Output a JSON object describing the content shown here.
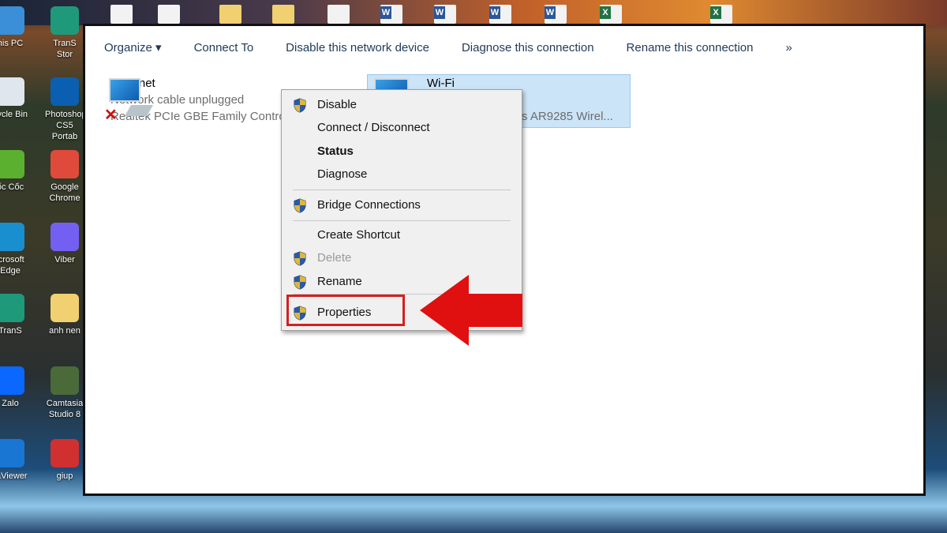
{
  "desktop": {
    "left_icons": [
      {
        "label": "his PC",
        "color": "#3a8fd8"
      },
      {
        "label": "cycle Bin",
        "color": "#dfe6ee"
      },
      {
        "label": "ốc Cốc",
        "color": "#5cb030"
      },
      {
        "label": "icrosoft Edge",
        "color": "#1a8fd0"
      },
      {
        "label": "TranS",
        "color": "#1e9a7a"
      },
      {
        "label": "Zalo",
        "color": "#0a68ff"
      },
      {
        "label": "raViewer",
        "color": "#1976d2"
      }
    ],
    "right_icons": [
      {
        "label": "TranS Stor",
        "color": "#1e9a7a"
      },
      {
        "label": "Photoshop CS5 Portab",
        "color": "#0b5fb0"
      },
      {
        "label": "Google Chrome",
        "color": "#e04a3a"
      },
      {
        "label": "Viber",
        "color": "#7360f2"
      },
      {
        "label": "anh nen",
        "color": "#f0d070"
      },
      {
        "label": "Camtasia Studio 8",
        "color": "#4a6a3a"
      },
      {
        "label": "giup",
        "color": "#d03030"
      }
    ]
  },
  "toolbar": {
    "organize": "Organize ▾",
    "connect_to": "Connect To",
    "disable": "Disable this network device",
    "diagnose": "Diagnose this connection",
    "rename": "Rename this connection",
    "more": "»"
  },
  "connections": [
    {
      "name": "Ethernet",
      "status": "Network cable unplugged",
      "device": "Realtek PCIe GBE Family Controller",
      "icon": "ethernet-disconnected-icon"
    },
    {
      "name": "Wi-Fi",
      "status": "",
      "device": "Qualcomm Atheros AR9285 Wirel...",
      "icon": "wifi-adapter-icon",
      "selected": true
    }
  ],
  "context_menu": {
    "items": [
      {
        "label": "Disable",
        "shield": true,
        "style": "normal"
      },
      {
        "label": "Connect / Disconnect",
        "shield": false,
        "style": "normal"
      },
      {
        "label": "Status",
        "shield": false,
        "style": "bold"
      },
      {
        "label": "Diagnose",
        "shield": false,
        "style": "normal"
      },
      {
        "label": "Bridge Connections",
        "shield": true,
        "style": "normal"
      },
      {
        "label": "Create Shortcut",
        "shield": false,
        "style": "normal"
      },
      {
        "label": "Delete",
        "shield": true,
        "style": "disabled"
      },
      {
        "label": "Rename",
        "shield": true,
        "style": "normal"
      },
      {
        "label": "Properties",
        "shield": true,
        "style": "normal",
        "highlighted": true
      }
    ]
  },
  "colors": {
    "annotation_red": "#e01010",
    "selection": "#cce4f7"
  }
}
